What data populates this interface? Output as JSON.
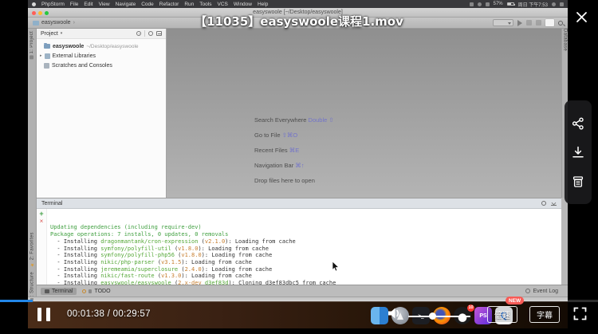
{
  "player": {
    "title": "【11035】easyswoole课程1.mov",
    "time_display": "00:01:38 / 00:29:57",
    "current_time": "00:01:38",
    "duration": "00:29:57",
    "progress_percent": 5.5,
    "speed_button_label": "倍速",
    "speed_new_badge": "NEW",
    "subtitle_button_label": "字幕",
    "progress_color": "#2287e8",
    "badge_color": "#f85a55"
  },
  "menubar": {
    "menus": [
      "PhpStorm",
      "File",
      "Edit",
      "View",
      "Navigate",
      "Code",
      "Refactor",
      "Run",
      "Tools",
      "VCS",
      "Window",
      "Help"
    ],
    "battery_percent": "57%",
    "clock": "周日 下午7:53"
  },
  "window": {
    "title": "easyswoole [~/Desktop/easyswoole]"
  },
  "toolbar": {
    "breadcrumb": "easyswoole"
  },
  "tool_tabs": {
    "left_top": "1: Project",
    "left_bottom": [
      "2: Favorites",
      "7: Structure"
    ],
    "right": "Database"
  },
  "project": {
    "header": "Project",
    "root_name": "easyswoole",
    "root_path": "~/Desktop/easyswoole",
    "items": [
      "External Libraries",
      "Scratches and Consoles"
    ]
  },
  "editor_hints": {
    "shortcut_color": "#7374c9",
    "rows": [
      {
        "label": "Search Everywhere",
        "shortcut": "Double ⇧"
      },
      {
        "label": "Go to File",
        "shortcut": "⇧⌘O"
      },
      {
        "label": "Recent Files",
        "shortcut": "⌘E"
      },
      {
        "label": "Navigation Bar",
        "shortcut": "⌘↑"
      },
      {
        "label": "Drop files here to open",
        "shortcut": ""
      }
    ]
  },
  "terminal": {
    "title": "Terminal",
    "text_colors": {
      "green": "#3f9f3f",
      "pkg": "#54a736",
      "ver": "#c77e2e",
      "hash": "#54a736",
      "default": "#333333"
    },
    "lines": [
      {
        "parts": [
          {
            "text": "Updating dependencies (including require-dev)",
            "color": "green"
          }
        ]
      },
      {
        "parts": [
          {
            "text": "Package operations: 7 installs, 0 updates, 0 removals",
            "color": "green"
          }
        ]
      },
      {
        "parts": [
          {
            "text": "  - Installing ",
            "color": "default"
          },
          {
            "text": "dragonmantank/cron-expression",
            "color": "pkg"
          },
          {
            "text": " (",
            "color": "default"
          },
          {
            "text": "v2.1.0",
            "color": "ver"
          },
          {
            "text": "): Loading from cache",
            "color": "default"
          }
        ]
      },
      {
        "parts": [
          {
            "text": "  - Installing ",
            "color": "default"
          },
          {
            "text": "symfony/polyfill-util",
            "color": "pkg"
          },
          {
            "text": " (",
            "color": "default"
          },
          {
            "text": "v1.8.0",
            "color": "ver"
          },
          {
            "text": "): Loading from cache",
            "color": "default"
          }
        ]
      },
      {
        "parts": [
          {
            "text": "  - Installing ",
            "color": "default"
          },
          {
            "text": "symfony/polyfill-php56",
            "color": "pkg"
          },
          {
            "text": " (",
            "color": "default"
          },
          {
            "text": "v1.8.0",
            "color": "ver"
          },
          {
            "text": "): Loading from cache",
            "color": "default"
          }
        ]
      },
      {
        "parts": [
          {
            "text": "  - Installing ",
            "color": "default"
          },
          {
            "text": "nikic/php-parser",
            "color": "pkg"
          },
          {
            "text": " (",
            "color": "default"
          },
          {
            "text": "v3.1.5",
            "color": "ver"
          },
          {
            "text": "): Loading from cache",
            "color": "default"
          }
        ]
      },
      {
        "parts": [
          {
            "text": "  - Installing ",
            "color": "default"
          },
          {
            "text": "jeremeamia/superclosure",
            "color": "pkg"
          },
          {
            "text": " (",
            "color": "default"
          },
          {
            "text": "2.4.0",
            "color": "ver"
          },
          {
            "text": "): Loading from cache",
            "color": "default"
          }
        ]
      },
      {
        "parts": [
          {
            "text": "  - Installing ",
            "color": "default"
          },
          {
            "text": "nikic/fast-route",
            "color": "pkg"
          },
          {
            "text": " (",
            "color": "default"
          },
          {
            "text": "v1.3.0",
            "color": "ver"
          },
          {
            "text": "): Loading from cache",
            "color": "default"
          }
        ]
      },
      {
        "parts": [
          {
            "text": "  - Installing ",
            "color": "default"
          },
          {
            "text": "easyswoole/easyswoole",
            "color": "pkg"
          },
          {
            "text": " (",
            "color": "default"
          },
          {
            "text": "2.x-dev",
            "color": "ver"
          },
          {
            "text": " ",
            "color": "default"
          },
          {
            "text": "d3ef83d",
            "color": "hash"
          },
          {
            "text": "): Cloning d3ef83dbc5 from cache",
            "color": "default"
          }
        ]
      }
    ]
  },
  "bottom_bar": {
    "tabs": [
      "Terminal",
      "TODO"
    ],
    "event_log": "Event Log"
  },
  "dock": {
    "apps": [
      {
        "name": "finder"
      },
      {
        "name": "launchpad"
      },
      {
        "name": "terminal"
      },
      {
        "name": "firefox"
      },
      {
        "name": "qq",
        "badge": "10"
      },
      {
        "name": "phpstorm",
        "label": "PS"
      },
      {
        "name": "quicktime",
        "label": "Q"
      }
    ]
  }
}
